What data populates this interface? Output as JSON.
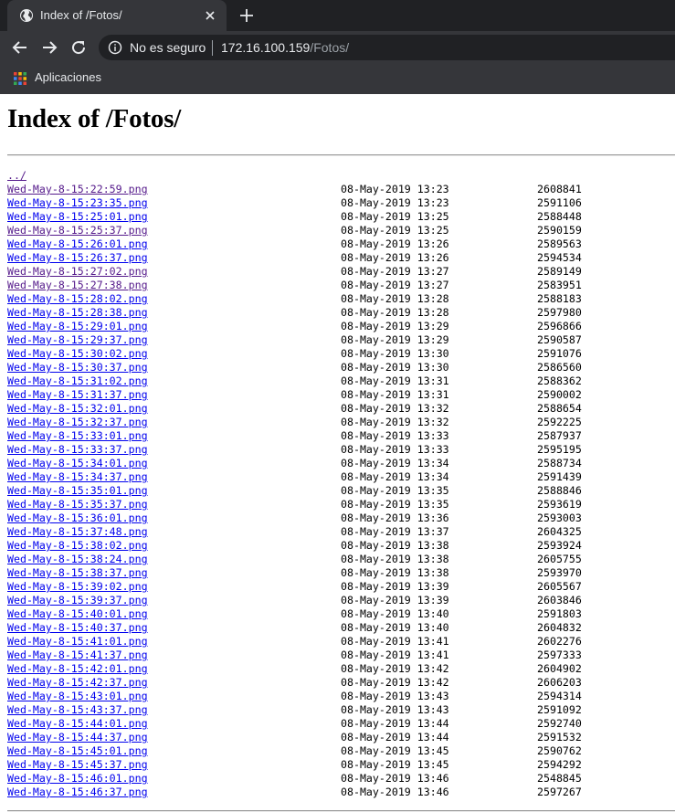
{
  "browser": {
    "tab_title": "Index of /Fotos/",
    "security_label": "No es seguro",
    "url_host": "172.16.100.159",
    "url_path": "/Fotos/",
    "bookmarks": [
      {
        "label": "Aplicaciones",
        "icon": "apps-grid-icon"
      }
    ],
    "colors": {
      "frame": "#202124",
      "toolbar": "#35363a",
      "text": "#e8eaed",
      "muted": "#9aa0a6"
    }
  },
  "page": {
    "heading": "Index of /Fotos/",
    "parent_link": "../",
    "colors": {
      "link": "#0000ee",
      "visited_link": "#551a8b"
    },
    "files": [
      {
        "name": "Wed-May-8-15:22:59.png",
        "date": "08-May-2019 13:23",
        "size": "2608841",
        "visited": true
      },
      {
        "name": "Wed-May-8-15:23:35.png",
        "date": "08-May-2019 13:23",
        "size": "2591106",
        "visited": false
      },
      {
        "name": "Wed-May-8-15:25:01.png",
        "date": "08-May-2019 13:25",
        "size": "2588448",
        "visited": false
      },
      {
        "name": "Wed-May-8-15:25:37.png",
        "date": "08-May-2019 13:25",
        "size": "2590159",
        "visited": true
      },
      {
        "name": "Wed-May-8-15:26:01.png",
        "date": "08-May-2019 13:26",
        "size": "2589563",
        "visited": false
      },
      {
        "name": "Wed-May-8-15:26:37.png",
        "date": "08-May-2019 13:26",
        "size": "2594534",
        "visited": false
      },
      {
        "name": "Wed-May-8-15:27:02.png",
        "date": "08-May-2019 13:27",
        "size": "2589149",
        "visited": true
      },
      {
        "name": "Wed-May-8-15:27:38.png",
        "date": "08-May-2019 13:27",
        "size": "2583951",
        "visited": true
      },
      {
        "name": "Wed-May-8-15:28:02.png",
        "date": "08-May-2019 13:28",
        "size": "2588183",
        "visited": false
      },
      {
        "name": "Wed-May-8-15:28:38.png",
        "date": "08-May-2019 13:28",
        "size": "2597980",
        "visited": false
      },
      {
        "name": "Wed-May-8-15:29:01.png",
        "date": "08-May-2019 13:29",
        "size": "2596866",
        "visited": false
      },
      {
        "name": "Wed-May-8-15:29:37.png",
        "date": "08-May-2019 13:29",
        "size": "2590587",
        "visited": false
      },
      {
        "name": "Wed-May-8-15:30:02.png",
        "date": "08-May-2019 13:30",
        "size": "2591076",
        "visited": false
      },
      {
        "name": "Wed-May-8-15:30:37.png",
        "date": "08-May-2019 13:30",
        "size": "2586560",
        "visited": false
      },
      {
        "name": "Wed-May-8-15:31:02.png",
        "date": "08-May-2019 13:31",
        "size": "2588362",
        "visited": false
      },
      {
        "name": "Wed-May-8-15:31:37.png",
        "date": "08-May-2019 13:31",
        "size": "2590002",
        "visited": false
      },
      {
        "name": "Wed-May-8-15:32:01.png",
        "date": "08-May-2019 13:32",
        "size": "2588654",
        "visited": false
      },
      {
        "name": "Wed-May-8-15:32:37.png",
        "date": "08-May-2019 13:32",
        "size": "2592225",
        "visited": false
      },
      {
        "name": "Wed-May-8-15:33:01.png",
        "date": "08-May-2019 13:33",
        "size": "2587937",
        "visited": false
      },
      {
        "name": "Wed-May-8-15:33:37.png",
        "date": "08-May-2019 13:33",
        "size": "2595195",
        "visited": false
      },
      {
        "name": "Wed-May-8-15:34:01.png",
        "date": "08-May-2019 13:34",
        "size": "2588734",
        "visited": false
      },
      {
        "name": "Wed-May-8-15:34:37.png",
        "date": "08-May-2019 13:34",
        "size": "2591439",
        "visited": false
      },
      {
        "name": "Wed-May-8-15:35:01.png",
        "date": "08-May-2019 13:35",
        "size": "2588846",
        "visited": false
      },
      {
        "name": "Wed-May-8-15:35:37.png",
        "date": "08-May-2019 13:35",
        "size": "2593619",
        "visited": false
      },
      {
        "name": "Wed-May-8-15:36:01.png",
        "date": "08-May-2019 13:36",
        "size": "2593003",
        "visited": false
      },
      {
        "name": "Wed-May-8-15:37:48.png",
        "date": "08-May-2019 13:37",
        "size": "2604325",
        "visited": false
      },
      {
        "name": "Wed-May-8-15:38:02.png",
        "date": "08-May-2019 13:38",
        "size": "2593924",
        "visited": false
      },
      {
        "name": "Wed-May-8-15:38:24.png",
        "date": "08-May-2019 13:38",
        "size": "2605755",
        "visited": false
      },
      {
        "name": "Wed-May-8-15:38:37.png",
        "date": "08-May-2019 13:38",
        "size": "2593970",
        "visited": false
      },
      {
        "name": "Wed-May-8-15:39:02.png",
        "date": "08-May-2019 13:39",
        "size": "2605567",
        "visited": false
      },
      {
        "name": "Wed-May-8-15:39:37.png",
        "date": "08-May-2019 13:39",
        "size": "2603846",
        "visited": false
      },
      {
        "name": "Wed-May-8-15:40:01.png",
        "date": "08-May-2019 13:40",
        "size": "2591803",
        "visited": false
      },
      {
        "name": "Wed-May-8-15:40:37.png",
        "date": "08-May-2019 13:40",
        "size": "2604832",
        "visited": false
      },
      {
        "name": "Wed-May-8-15:41:01.png",
        "date": "08-May-2019 13:41",
        "size": "2602276",
        "visited": false
      },
      {
        "name": "Wed-May-8-15:41:37.png",
        "date": "08-May-2019 13:41",
        "size": "2597333",
        "visited": false
      },
      {
        "name": "Wed-May-8-15:42:01.png",
        "date": "08-May-2019 13:42",
        "size": "2604902",
        "visited": false
      },
      {
        "name": "Wed-May-8-15:42:37.png",
        "date": "08-May-2019 13:42",
        "size": "2606203",
        "visited": false
      },
      {
        "name": "Wed-May-8-15:43:01.png",
        "date": "08-May-2019 13:43",
        "size": "2594314",
        "visited": false
      },
      {
        "name": "Wed-May-8-15:43:37.png",
        "date": "08-May-2019 13:43",
        "size": "2591092",
        "visited": false
      },
      {
        "name": "Wed-May-8-15:44:01.png",
        "date": "08-May-2019 13:44",
        "size": "2592740",
        "visited": false
      },
      {
        "name": "Wed-May-8-15:44:37.png",
        "date": "08-May-2019 13:44",
        "size": "2591532",
        "visited": false
      },
      {
        "name": "Wed-May-8-15:45:01.png",
        "date": "08-May-2019 13:45",
        "size": "2590762",
        "visited": false
      },
      {
        "name": "Wed-May-8-15:45:37.png",
        "date": "08-May-2019 13:45",
        "size": "2594292",
        "visited": false
      },
      {
        "name": "Wed-May-8-15:46:01.png",
        "date": "08-May-2019 13:46",
        "size": "2548845",
        "visited": false
      },
      {
        "name": "Wed-May-8-15:46:37.png",
        "date": "08-May-2019 13:46",
        "size": "2597267",
        "visited": false
      }
    ]
  }
}
